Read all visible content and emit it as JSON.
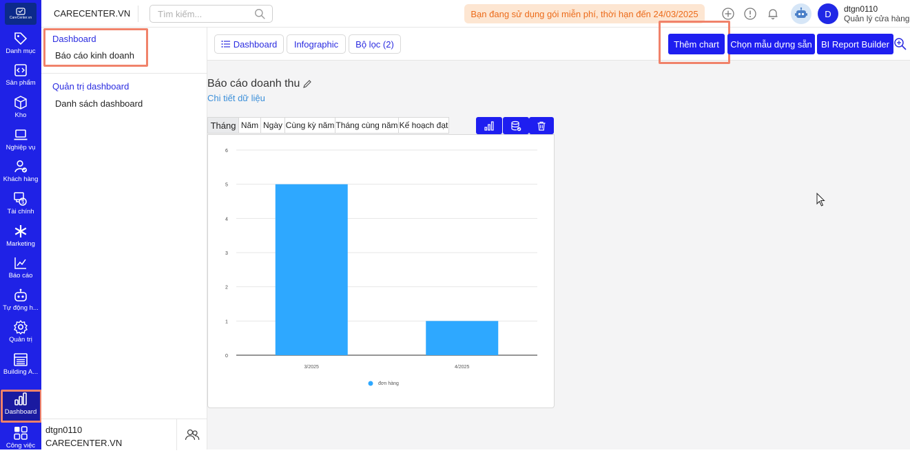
{
  "app": {
    "brand": "CARECENTER.VN",
    "logo_text": "CareCenter.vn"
  },
  "search": {
    "placeholder": "Tìm kiếm..."
  },
  "promo": "Bạn đang sử dụng gói miễn phí, thời hạn đến 24/03/2025",
  "user": {
    "initial": "D",
    "name": "dtgn0110",
    "role": "Quản lý cửa hàng"
  },
  "rail": [
    {
      "label": "Danh mục",
      "icon": "tag-icon"
    },
    {
      "label": "Sản phẩm",
      "icon": "code-icon"
    },
    {
      "label": "Kho",
      "icon": "box-icon"
    },
    {
      "label": "Nghiệp vụ",
      "icon": "laptop-icon"
    },
    {
      "label": "Khách hàng",
      "icon": "user-check-icon"
    },
    {
      "label": "Tài chính",
      "icon": "finance-icon"
    },
    {
      "label": "Marketing",
      "icon": "asterisk-icon"
    },
    {
      "label": "Báo cáo",
      "icon": "line-chart-icon"
    },
    {
      "label": "Tự động h...",
      "icon": "robot-icon"
    },
    {
      "label": "Quản trị",
      "icon": "gear-icon"
    },
    {
      "label": "Building A...",
      "icon": "building-icon"
    },
    {
      "label": "Dashboard",
      "icon": "bar-chart-icon"
    },
    {
      "label": "Công việc",
      "icon": "grid-icon"
    }
  ],
  "panel": {
    "group1": "Dashboard",
    "item1": "Báo cáo kinh doanh",
    "group2": "Quản trị dashboard",
    "item2": "Danh sách dashboard",
    "footer_name": "dtgn0110",
    "footer_org": "CARECENTER.VN"
  },
  "toolbar": {
    "dashboard_label": "Dashboard",
    "infographic_label": "Infographic",
    "filter_label": "Bộ lọc (2)",
    "add_chart_label": "Thêm chart",
    "template_label": "Chọn mẫu dựng sẵn",
    "bi_label": "BI Report Builder"
  },
  "report": {
    "title": "Báo cáo doanh thu",
    "detail_link": "Chi tiết dữ liệu",
    "tabs": [
      "Tháng",
      "Năm",
      "Ngày",
      "Cùng kỳ năm",
      "Tháng cùng năm",
      "Kế hoạch đạt"
    ],
    "active_tab": "Tháng"
  },
  "colors": {
    "accent": "#1e1ef0",
    "bar": "#2ea8ff",
    "promo_text": "#ec6b1a",
    "rail": "#1f22e6"
  },
  "chart_data": {
    "type": "bar",
    "categories": [
      "3/2025",
      "4/2025"
    ],
    "series": [
      {
        "name": "đơn hàng",
        "values": [
          5,
          1
        ]
      }
    ],
    "yticks": [
      "0",
      "1",
      "2",
      "3",
      "4",
      "5",
      "6"
    ],
    "ylim": [
      0,
      6
    ],
    "grid": true,
    "legend": "bottom"
  }
}
